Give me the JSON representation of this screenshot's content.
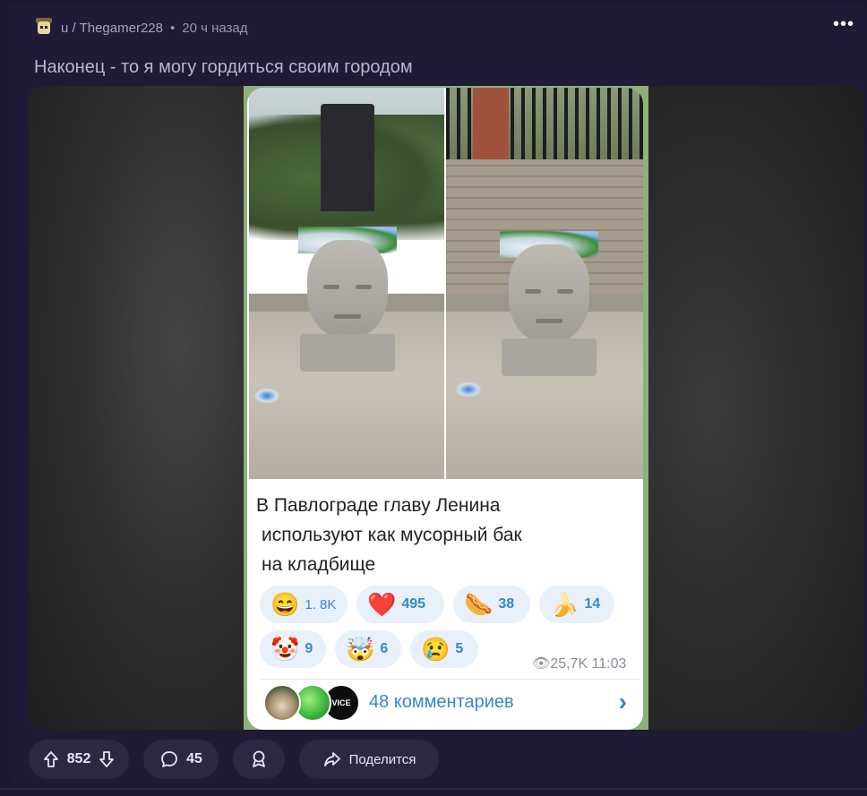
{
  "post": {
    "author": "u / Thegamer228",
    "separator": "•",
    "time": "20 ч назад",
    "more": "•••",
    "title": "Наконец - то я могу гордиться своим городом"
  },
  "telegram_card": {
    "caption_lines": [
      "В Павлограде главу Ленина",
      "используют как мусорный бак",
      "на кладбище"
    ],
    "reactions": [
      {
        "emoji": "😄",
        "count": "1. 8K"
      },
      {
        "emoji": "❤️",
        "count": "495"
      },
      {
        "emoji": "🌭",
        "count": "38"
      },
      {
        "emoji": "🍌",
        "count": "14"
      },
      {
        "emoji": "🤡",
        "count": "9"
      },
      {
        "emoji": "🤯",
        "count": "6"
      },
      {
        "emoji": "😢",
        "count": "5"
      }
    ],
    "views_time": "👁25,7K 11:03",
    "comments_label": "48 комментариев",
    "comments_chevron": "›",
    "avatar3_text": "VICE"
  },
  "actions": {
    "upvote_count": "852",
    "comment_count": "45",
    "share_label": "Поделится"
  },
  "colors": {
    "background": "#1b1830",
    "post_bg": "#1f1b36",
    "pill_bg": "#2c2844",
    "tg_accent": "#3a86c8",
    "tg_reaction_bg": "#e7f0fb"
  }
}
